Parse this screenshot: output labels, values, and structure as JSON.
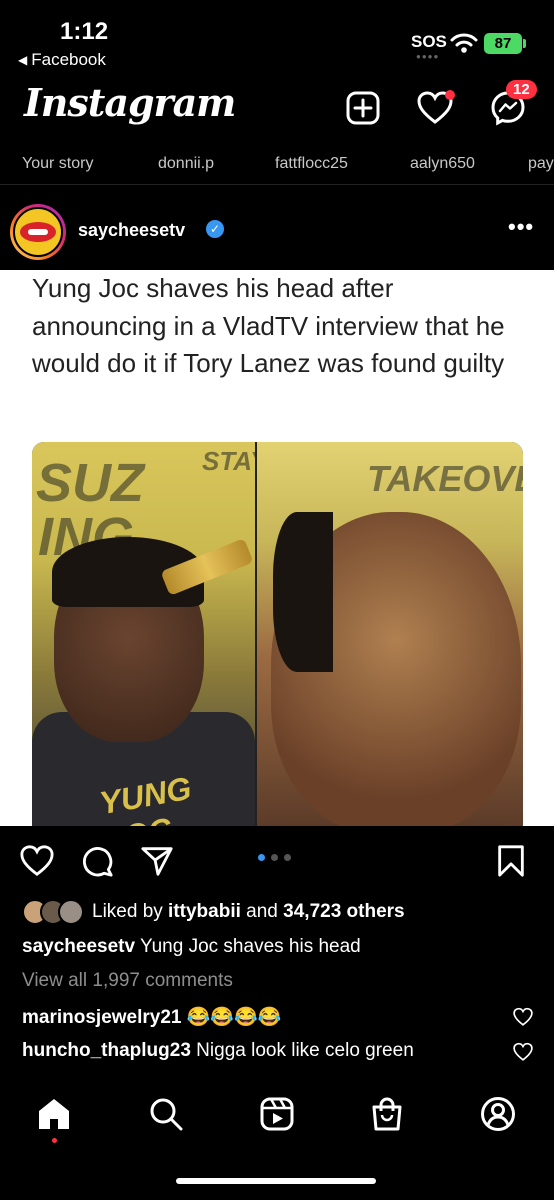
{
  "status_bar": {
    "time": "1:12",
    "back_app": "Facebook",
    "signal": "SOS",
    "battery": "87"
  },
  "header": {
    "logo": "Instagram",
    "messages_badge": "12"
  },
  "stories": [
    "Your story",
    "donnii.p",
    "fattflocc25",
    "aalyn650",
    "pay"
  ],
  "post": {
    "username": "saycheesetv",
    "headline": "Yung Joc shaves his head after announcing in a VladTV interview that he would do it if Tory Lanez was found guilty",
    "image_text_left": "STAY",
    "image_text_right": "TAKEOVER",
    "hoodie_text": "YUNG JOC",
    "likes_prefix": "Liked by ",
    "liked_by": "ittybabii",
    "likes_and": " and ",
    "likes_count": "34,723 others",
    "caption_user": "saycheesetv",
    "caption_text": " Yung Joc shaves his head",
    "view_comments": "View all 1,997 comments",
    "comments": [
      {
        "user": "marinosjewelry21",
        "text": " 😂😂😂😂"
      },
      {
        "user": "huncho_thaplug23",
        "text": " Nigga look like celo green"
      }
    ]
  },
  "colors": {
    "accent": "#3897f0",
    "notification": "#ff3040",
    "battery": "#4cd964"
  }
}
